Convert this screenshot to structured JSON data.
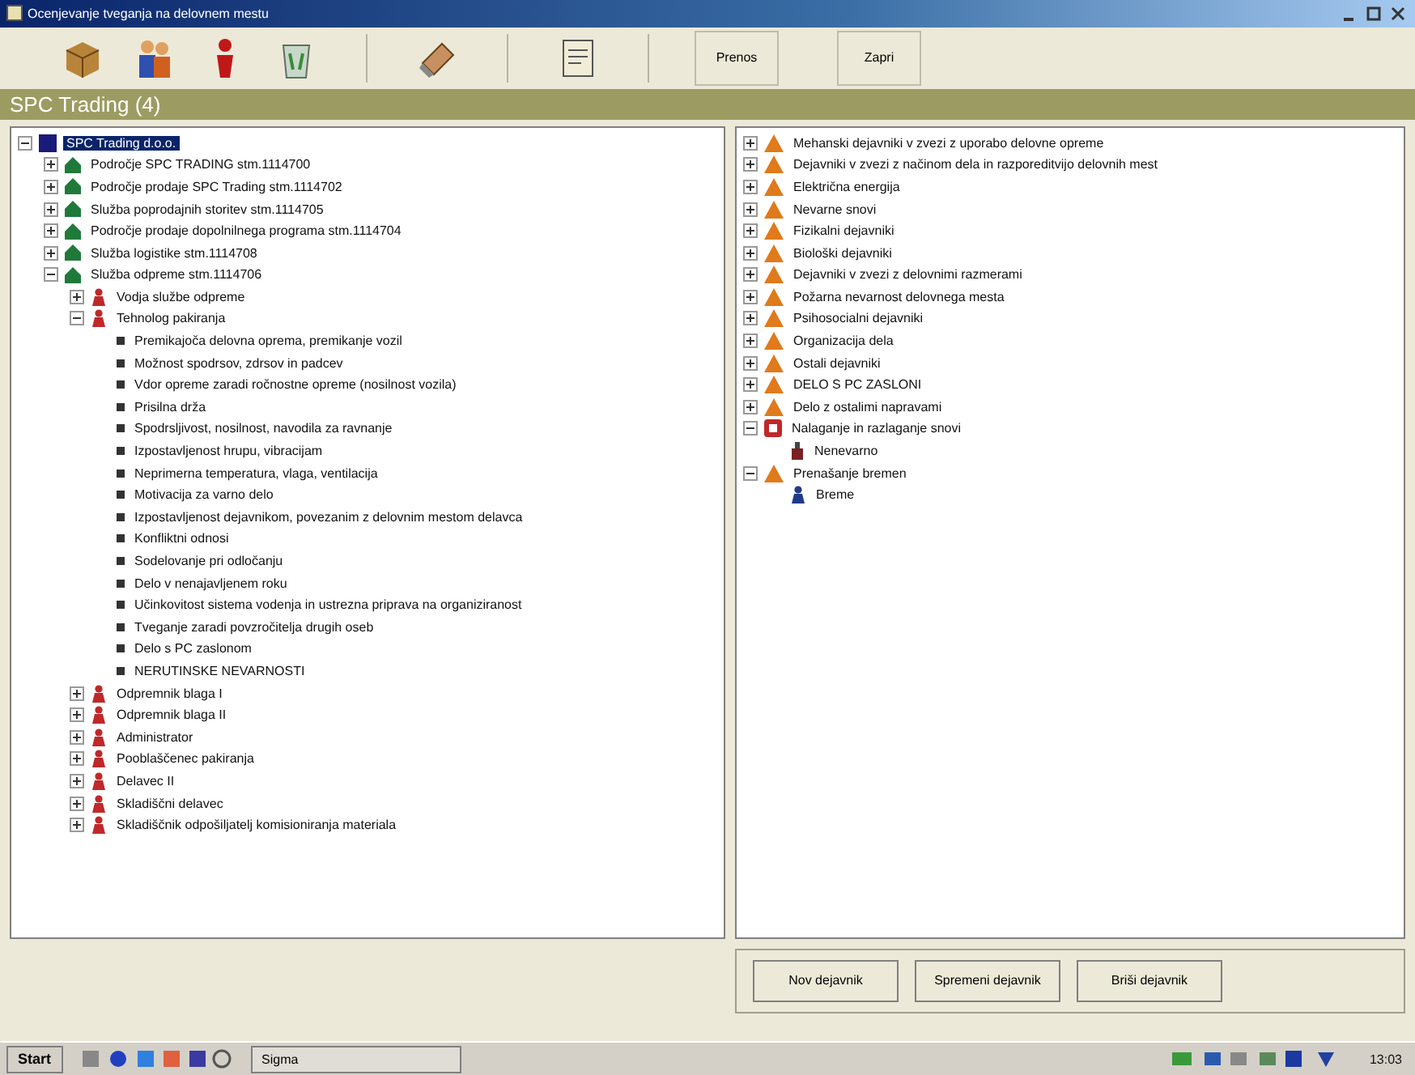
{
  "window": {
    "title": "Ocenjevanje tveganja na delovnem mestu"
  },
  "toolbar": {
    "buttons": [
      "Prenos",
      "Zapri"
    ]
  },
  "header": {
    "title": "SPC Trading (4)"
  },
  "left_tree": [
    {
      "label": "SPC Trading d.o.o.",
      "kind": "root",
      "selected": true,
      "expanded": true,
      "children": [
        {
          "label": "Področje SPC TRADING  stm.1114700",
          "kind": "unit",
          "expanded": false
        },
        {
          "label": "Področje prodaje SPC Trading  stm.1114702",
          "kind": "unit",
          "expanded": false
        },
        {
          "label": "Služba poprodajnih storitev  stm.1114705",
          "kind": "unit",
          "expanded": false
        },
        {
          "label": "Področje prodaje dopolnilnega programa  stm.1114704",
          "kind": "unit",
          "expanded": false
        },
        {
          "label": "Služba logistike  stm.1114708",
          "kind": "unit",
          "expanded": false
        },
        {
          "label": "Služba odpreme  stm.1114706",
          "kind": "unit",
          "expanded": true,
          "children": [
            {
              "label": "Vodja službe odpreme",
              "kind": "role",
              "expanded": false
            },
            {
              "label": "Tehnolog pakiranja",
              "kind": "role",
              "expanded": true,
              "children": [
                {
                  "label": "Premikajoča delovna oprema, premikanje vozil",
                  "kind": "hazard"
                },
                {
                  "label": "Možnost spodrsov, zdrsov in padcev",
                  "kind": "hazard"
                },
                {
                  "label": "Vdor opreme zaradi ročnostne opreme (nosilnost vozila)",
                  "kind": "hazard"
                },
                {
                  "label": "Prisilna drža",
                  "kind": "hazard"
                },
                {
                  "label": "Spodrsljivost, nosilnost, navodila za ravnanje",
                  "kind": "hazard"
                },
                {
                  "label": "Izpostavljenost hrupu, vibracijam",
                  "kind": "hazard"
                },
                {
                  "label": "Neprimerna temperatura, vlaga, ventilacija",
                  "kind": "hazard"
                },
                {
                  "label": "Motivacija za varno delo",
                  "kind": "hazard"
                },
                {
                  "label": "Izpostavljenost dejavnikom, povezanim z delovnim mestom delavca",
                  "kind": "hazard"
                },
                {
                  "label": "Konfliktni odnosi",
                  "kind": "hazard"
                },
                {
                  "label": "Sodelovanje pri odločanju",
                  "kind": "hazard"
                },
                {
                  "label": "Delo v nenajavljenem roku",
                  "kind": "hazard"
                },
                {
                  "label": "Učinkovitost sistema vodenja in ustrezna priprava na organiziranost",
                  "kind": "hazard"
                },
                {
                  "label": "Tveganje zaradi povzročitelja drugih oseb",
                  "kind": "hazard"
                },
                {
                  "label": "Delo s PC zaslonom",
                  "kind": "hazard"
                },
                {
                  "label": "NERUTINSKE NEVARNOSTI",
                  "kind": "hazard"
                }
              ]
            },
            {
              "label": "Odpremnik blaga I",
              "kind": "role",
              "expanded": false
            },
            {
              "label": "Odpremnik blaga II",
              "kind": "role",
              "expanded": false
            },
            {
              "label": "Administrator",
              "kind": "role",
              "expanded": false
            },
            {
              "label": "Pooblaščenec pakiranja",
              "kind": "role",
              "expanded": false
            },
            {
              "label": "Delavec II",
              "kind": "role",
              "expanded": false
            },
            {
              "label": "Skladiščni delavec",
              "kind": "role",
              "expanded": false
            },
            {
              "label": "Skladiščnik odpošiljatelj komisioniranja materiala",
              "kind": "role",
              "expanded": false
            }
          ]
        }
      ]
    }
  ],
  "right_tree": [
    {
      "label": "Mehanski dejavniki v zvezi z uporabo delovne opreme",
      "kind": "factor",
      "expanded": false
    },
    {
      "label": "Dejavniki v zvezi z načinom dela in razporeditvijo delovnih mest",
      "kind": "factor",
      "expanded": false
    },
    {
      "label": "Električna energija",
      "kind": "factor",
      "expanded": false
    },
    {
      "label": "Nevarne snovi",
      "kind": "factor",
      "expanded": false
    },
    {
      "label": "Fizikalni dejavniki",
      "kind": "factor",
      "expanded": false
    },
    {
      "label": "Biološki dejavniki",
      "kind": "factor",
      "expanded": false
    },
    {
      "label": "Dejavniki v zvezi z delovnimi razmerami",
      "kind": "factor",
      "expanded": false
    },
    {
      "label": "Požarna nevarnost delovnega mesta",
      "kind": "factor",
      "expanded": false
    },
    {
      "label": "Psihosocialni dejavniki",
      "kind": "factor",
      "expanded": false
    },
    {
      "label": "Organizacija dela",
      "kind": "factor",
      "expanded": false
    },
    {
      "label": "Ostali dejavniki",
      "kind": "factor",
      "expanded": false
    },
    {
      "label": "DELO S PC ZASLONI",
      "kind": "factor",
      "expanded": false
    },
    {
      "label": "Delo z ostalimi napravami",
      "kind": "factor",
      "expanded": false
    },
    {
      "label": "Nalaganje in razlaganje snovi",
      "kind": "special",
      "expanded": true,
      "children": [
        {
          "label": "Nenevarno",
          "kind": "item"
        }
      ]
    },
    {
      "label": "Prenašanje bremen",
      "kind": "factor",
      "expanded": true,
      "children": [
        {
          "label": "Breme",
          "kind": "person"
        }
      ]
    }
  ],
  "actions": [
    "Nov dejavnik",
    "Spremeni dejavnik",
    "Briši dejavnik"
  ],
  "taskbar": {
    "start": "Start",
    "task": "Sigma",
    "clock": "13:03"
  }
}
